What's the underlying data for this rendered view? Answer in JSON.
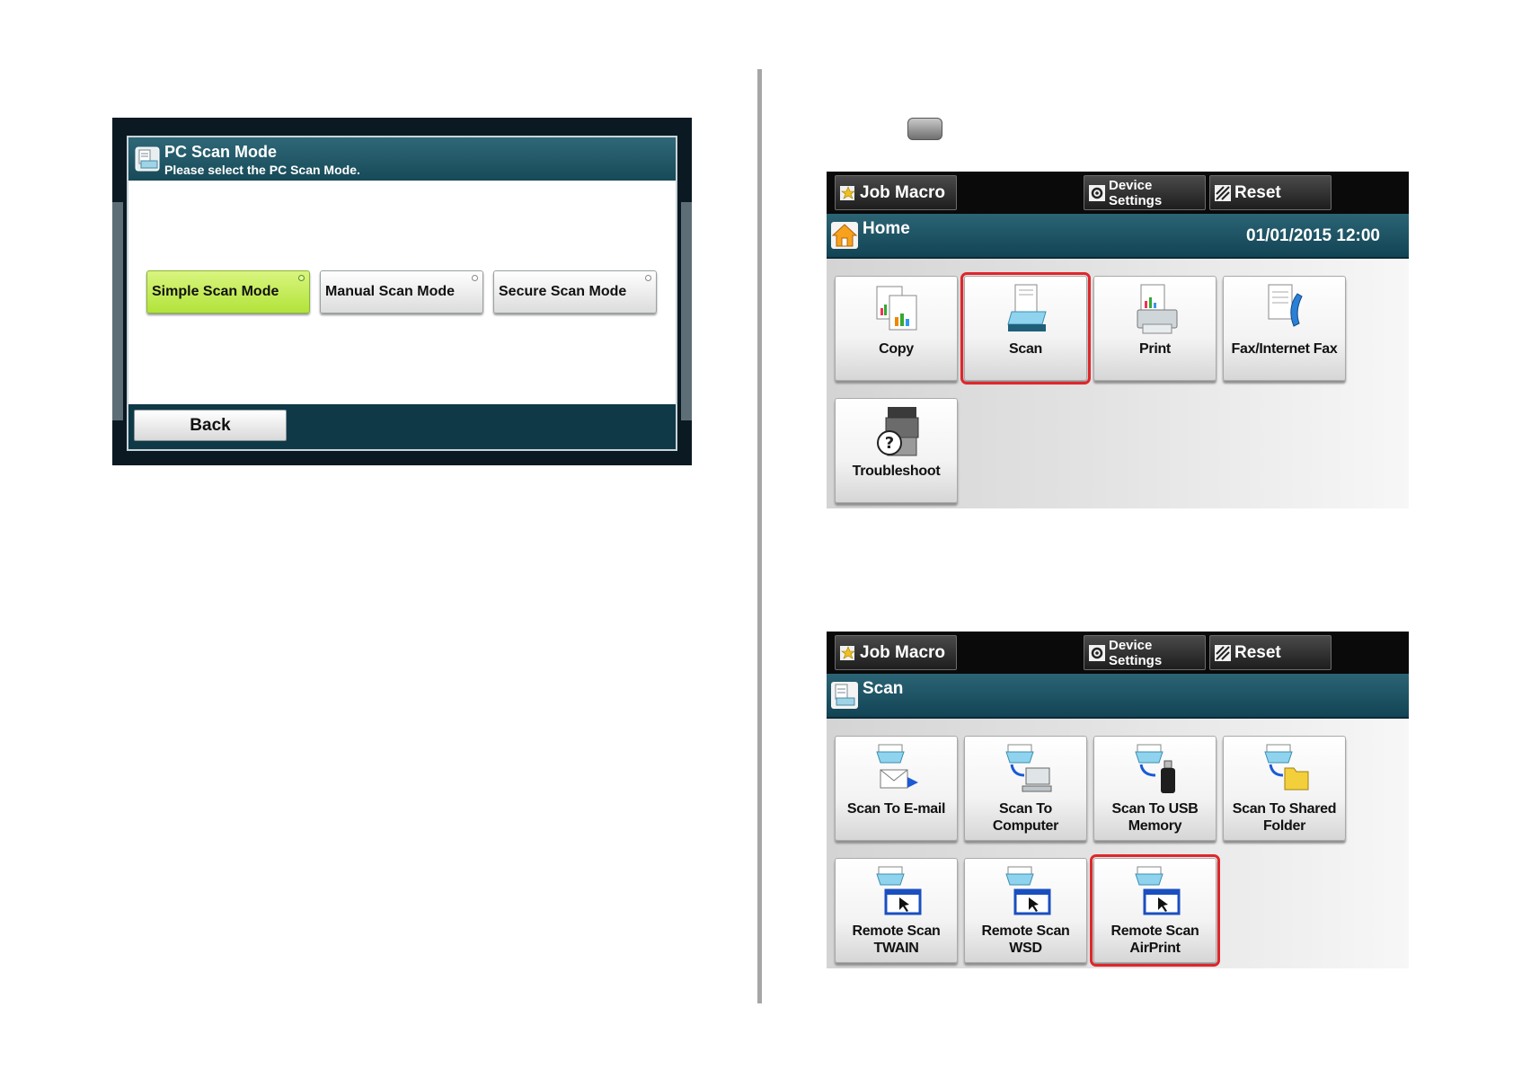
{
  "pc_scan_mode": {
    "title": "PC Scan Mode",
    "subtitle": "Please select the PC Scan Mode.",
    "modes": [
      {
        "label": "Simple Scan Mode",
        "selected": true
      },
      {
        "label": "Manual Scan Mode",
        "selected": false
      },
      {
        "label": "Secure Scan Mode",
        "selected": false
      }
    ],
    "back_label": "Back"
  },
  "home_screen": {
    "topbar": {
      "job_macro": "Job Macro",
      "device_settings_1": "Device",
      "device_settings_2": "Settings",
      "reset": "Reset"
    },
    "title": "Home",
    "datetime": "01/01/2015 12:00",
    "tiles": [
      {
        "label": "Copy",
        "icon": "copy-icon"
      },
      {
        "label": "Scan",
        "icon": "scan-icon",
        "highlighted": true
      },
      {
        "label": "Print",
        "icon": "print-icon"
      },
      {
        "label": "Fax/Internet Fax",
        "icon": "fax-icon"
      },
      {
        "label": "Troubleshoot",
        "icon": "troubleshoot-icon"
      }
    ]
  },
  "scan_screen": {
    "topbar": {
      "job_macro": "Job Macro",
      "device_settings_1": "Device",
      "device_settings_2": "Settings",
      "reset": "Reset"
    },
    "title": "Scan",
    "tiles": [
      {
        "line1": "Scan To E-mail",
        "line2": "",
        "icon": "scan-to-email-icon"
      },
      {
        "line1": "Scan To Computer",
        "line2": "",
        "icon": "scan-to-computer-icon"
      },
      {
        "line1": "Scan To USB",
        "line2": "Memory",
        "icon": "scan-to-usb-icon"
      },
      {
        "line1": "Scan To Shared",
        "line2": "Folder",
        "icon": "scan-to-folder-icon"
      },
      {
        "line1": "Remote Scan",
        "line2": "TWAIN",
        "icon": "remote-scan-icon"
      },
      {
        "line1": "Remote Scan WSD",
        "line2": "",
        "icon": "remote-scan-icon"
      },
      {
        "line1": "Remote Scan",
        "line2": "AirPrint",
        "icon": "remote-scan-icon",
        "highlighted": true
      }
    ]
  },
  "colors": {
    "highlight": "#e0262b",
    "title_bar": "#1f5666",
    "selected_mode": "#c6ec5a"
  }
}
